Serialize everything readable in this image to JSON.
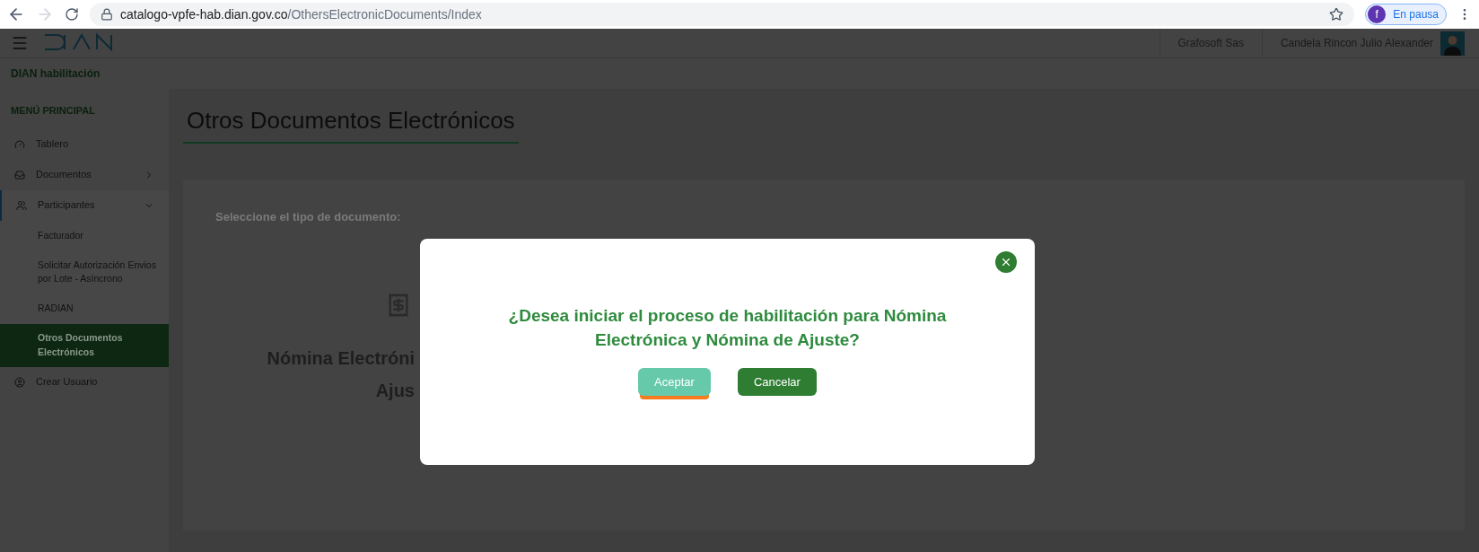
{
  "browser": {
    "url_host": "catalogo-vpfe-hab.dian.gov.co",
    "url_path": "/OthersElectronicDocuments/Index",
    "profile_initial": "f",
    "profile_status": "En pausa"
  },
  "header": {
    "company": "Grafosoft Sas",
    "user": "Candela Rincon Julio Alexander"
  },
  "environment": "DIAN habilitación",
  "sidebar": {
    "heading": "MENÚ PRINCIPAL",
    "items": [
      {
        "label": "Tablero",
        "selected": false
      },
      {
        "label": "Documentos",
        "expanded": false,
        "selected": false
      },
      {
        "label": "Participantes",
        "expanded": true,
        "selected": true,
        "children": [
          {
            "label": "Facturador",
            "selected": false
          },
          {
            "label": "Solicitar Autorización Envios por Lote - Asíncrono",
            "selected": false
          },
          {
            "label": "RADIAN",
            "selected": false
          },
          {
            "label": "Otros Documentos Electrónicos",
            "selected": true
          }
        ]
      },
      {
        "label": "Crear Usuario",
        "selected": false
      }
    ]
  },
  "page": {
    "title": "Otros Documentos Electrónicos",
    "prompt": "Seleccione el tipo de documento:",
    "card_lines": [
      "Nómina Electróni",
      "Ajus"
    ]
  },
  "dialog": {
    "message": "¿Desea iniciar el proceso de habilitación para Nómina Electrónica y Nómina de Ajuste?",
    "buttons": [
      {
        "label": "Aceptar",
        "kind": "primary",
        "focused": true
      },
      {
        "label": "Cancelar",
        "kind": "secondary",
        "focused": false
      }
    ]
  }
}
